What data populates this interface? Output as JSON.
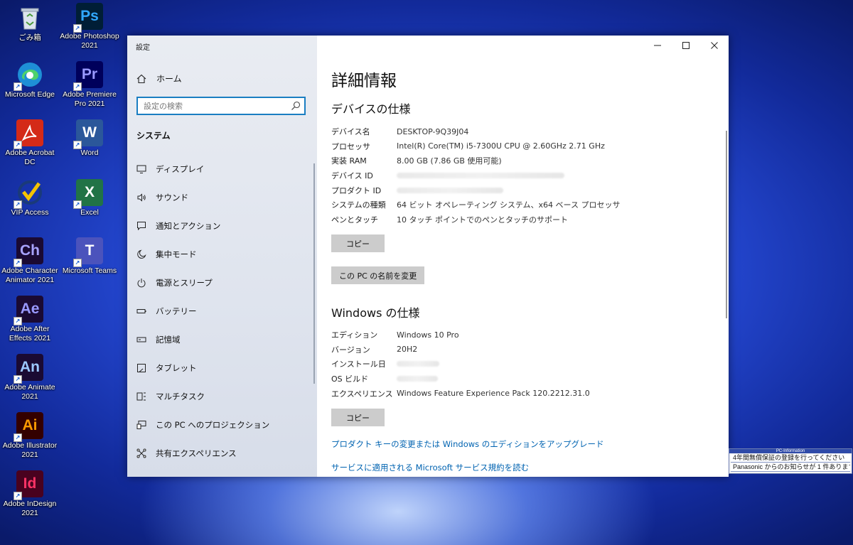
{
  "desktop": {
    "icons": [
      {
        "label": "ごみ箱",
        "glyph": "",
        "icon": "recycle-bin-icon",
        "bg": "#cfd8e6",
        "fg": "#444"
      },
      {
        "label": "Microsoft Edge",
        "glyph": "",
        "icon": "edge-icon",
        "bg": "#1e8fd6",
        "fg": "#fff"
      },
      {
        "label": "Adobe Acrobat DC",
        "glyph": "",
        "icon": "acrobat-icon",
        "bg": "#d42a18",
        "fg": "#fff"
      },
      {
        "label": "VIP Access",
        "glyph": "✓",
        "icon": "vip-access-icon",
        "bg": "#f4c300",
        "fg": "#1a3a7a"
      },
      {
        "label": "Adobe Character Animator 2021",
        "glyph": "Ch",
        "icon": "character-animator-icon",
        "bg": "#1a0a33",
        "fg": "#a8a3ff"
      },
      {
        "label": "Adobe After Effects 2021",
        "glyph": "Ae",
        "icon": "after-effects-icon",
        "bg": "#1a0a33",
        "fg": "#9999ff"
      },
      {
        "label": "Adobe Animate 2021",
        "glyph": "An",
        "icon": "animate-icon",
        "bg": "#1a0a33",
        "fg": "#9cc8ff"
      },
      {
        "label": "Adobe Illustrator 2021",
        "glyph": "Ai",
        "icon": "illustrator-icon",
        "bg": "#330000",
        "fg": "#ff9a00"
      },
      {
        "label": "Adobe InDesign 2021",
        "glyph": "Id",
        "icon": "indesign-icon",
        "bg": "#49021f",
        "fg": "#ff3366"
      },
      {
        "label": "Adobe Photoshop 2021",
        "glyph": "Ps",
        "icon": "photoshop-icon",
        "bg": "#001e36",
        "fg": "#31a8ff"
      },
      {
        "label": "Adobe Premiere Pro 2021",
        "glyph": "Pr",
        "icon": "premiere-pro-icon",
        "bg": "#00005b",
        "fg": "#9999ff"
      },
      {
        "label": "Word",
        "glyph": "W",
        "icon": "word-icon",
        "bg": "#2b579a",
        "fg": "#fff"
      },
      {
        "label": "Excel",
        "glyph": "X",
        "icon": "excel-icon",
        "bg": "#217346",
        "fg": "#fff"
      },
      {
        "label": "Microsoft Teams",
        "glyph": "T",
        "icon": "teams-icon",
        "bg": "#4b53bc",
        "fg": "#fff"
      }
    ]
  },
  "window": {
    "app_title": "設定",
    "sidebar": {
      "home": "ホーム",
      "search_placeholder": "設定の検索",
      "section": "システム",
      "items": [
        {
          "label": "ディスプレイ",
          "icon": "display-icon"
        },
        {
          "label": "サウンド",
          "icon": "sound-icon"
        },
        {
          "label": "通知とアクション",
          "icon": "notification-icon"
        },
        {
          "label": "集中モード",
          "icon": "focus-moon-icon"
        },
        {
          "label": "電源とスリープ",
          "icon": "power-icon"
        },
        {
          "label": "バッテリー",
          "icon": "battery-icon"
        },
        {
          "label": "記憶域",
          "icon": "storage-icon"
        },
        {
          "label": "タブレット",
          "icon": "tablet-icon"
        },
        {
          "label": "マルチタスク",
          "icon": "multitask-icon"
        },
        {
          "label": "この PC へのプロジェクション",
          "icon": "projection-icon"
        },
        {
          "label": "共有エクスペリエンス",
          "icon": "shared-experience-icon"
        }
      ]
    },
    "main": {
      "title": "詳細情報",
      "device_heading": "デバイスの仕様",
      "device_specs": [
        {
          "key": "デバイス名",
          "value": "DESKTOP-9Q39J04"
        },
        {
          "key": "プロセッサ",
          "value": "Intel(R) Core(TM) i5-7300U CPU @ 2.60GHz   2.71 GHz"
        },
        {
          "key": "実装 RAM",
          "value": "8.00 GB (7.86 GB 使用可能)"
        },
        {
          "key": "デバイス ID",
          "value": ""
        },
        {
          "key": "プロダクト ID",
          "value": ""
        },
        {
          "key": "システムの種類",
          "value": "64 ビット オペレーティング システム、x64 ベース プロセッサ"
        },
        {
          "key": "ペンとタッチ",
          "value": "10 タッチ ポイントでのペンとタッチのサポート"
        }
      ],
      "copy_label": "コピー",
      "rename_label": "この PC の名前を変更",
      "windows_heading": "Windows の仕様",
      "windows_specs": [
        {
          "key": "エディション",
          "value": "Windows 10 Pro"
        },
        {
          "key": "バージョン",
          "value": "20H2"
        },
        {
          "key": "インストール日",
          "value": ""
        },
        {
          "key": "OS ビルド",
          "value": ""
        },
        {
          "key": "エクスペリエンス",
          "value": "Windows Feature Experience Pack 120.2212.31.0"
        }
      ],
      "copy2_label": "コピー",
      "link1": "プロダクト キーの変更または Windows のエディションをアップグレード",
      "link2": "サービスに適用される Microsoft サービス規約を読む"
    }
  },
  "pc_information": {
    "title": "PC-Information",
    "lines": [
      "4年間無償保証の登録を行ってください",
      "Panasonic からのお知らせが 1 件あります"
    ]
  }
}
